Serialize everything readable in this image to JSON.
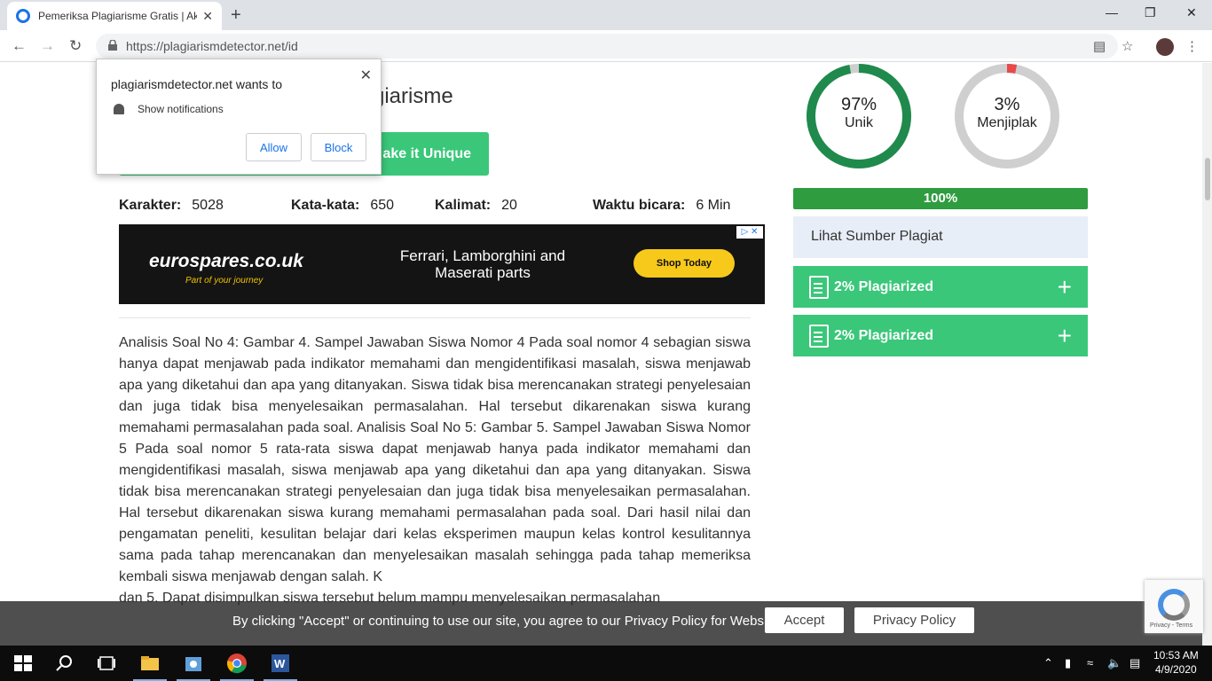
{
  "browser": {
    "tab_title": "Pemeriksa Plagiarisme Gratis | Ak",
    "tab_close": "✕",
    "new_tab": "+",
    "url": "https://plagiarismdetector.net/id",
    "minimize": "—",
    "maximize": "❐",
    "close": "✕"
  },
  "popup": {
    "title": "plagiarismdetector.net wants to",
    "permission": "Show notifications",
    "allow": "Allow",
    "block": "Block",
    "close": "✕"
  },
  "page": {
    "heading": "gia​rism​e",
    "heading_full": "giarisme",
    "make_unique": "ake it Unique",
    "stats": {
      "chars_label": "Karakter:",
      "chars_value": "5028",
      "words_label": "Kata-kata:",
      "words_value": "650",
      "sentences_label": "Kalimat:",
      "sentences_value": "20",
      "speak_label": "Waktu bicara:",
      "speak_value": "6 Min"
    },
    "ad": {
      "logo": "eurospares.co.uk",
      "tagline": "Part of your journey",
      "message": "Ferrari, Lamborghini and Maserati parts",
      "cta": "Shop Today",
      "adchoice": "▷ ✕"
    },
    "body_text": "Analisis Soal No 4: Gambar 4. Sampel Jawaban Siswa Nomor 4 Pada soal nomor 4 sebagian siswa hanya dapat menjawab pada indikator memahami dan mengidentifikasi masalah, siswa menjawab apa yang diketahui dan apa yang ditanyakan. Siswa tidak bisa merencanakan strategi penyelesaian dan juga tidak bisa menyelesaikan permasalahan. Hal tersebut dikarenakan siswa kurang memahami permasalahan pada soal. Analisis Soal No 5: Gambar 5. Sampel Jawaban Siswa Nomor 5 Pada soal nomor 5 rata-rata siswa dapat menjawab hanya pada indikator memahami dan mengidentifikasi masalah, siswa menjawab apa yang diketahui dan apa yang ditanyakan. Siswa tidak bisa merencanakan strategi penyelesaian dan juga tidak bisa menyelesaikan permasalahan. Hal tersebut dikarenakan siswa kurang memahami permasalahan pada soal. Dari hasil nilai dan pengamatan peneliti, kesulitan belajar dari kelas eksperimen maupun kelas kontrol kesulitannya sama pada tahap merencanakan dan menyelesaikan masalah sehingga pada tahap memeriksa kembali siswa menjawab dengan salah. K",
    "body_text_tail": "dan 5. Dapat disimpulkan siswa tersebut belum mampu menyelesaikan permasalahan"
  },
  "results": {
    "unique_pct": "97%",
    "unique_value": 97,
    "unique_label": "Unik",
    "plag_pct": "3%",
    "plag_value": 3,
    "plag_label": "Menjiplak",
    "progress": "100%",
    "sources_label": "Lihat Sumber Plagiat",
    "items": [
      {
        "label": "2% Plagiarized"
      },
      {
        "label": "2% Plagiarized"
      }
    ],
    "colors": {
      "unique": "#1f8a4c",
      "plag": "#e84a4a",
      "track": "#cfcfcf"
    }
  },
  "cookie": {
    "text": "By clicking \"Accept\" or continuing to use our site, you agree to our Privacy Policy for Website",
    "accept": "Accept",
    "privacy": "Privacy Policy"
  },
  "recaptcha": {
    "text": "Privacy - Terms"
  },
  "taskbar": {
    "time": "10:53 AM",
    "date": "4/9/2020"
  }
}
